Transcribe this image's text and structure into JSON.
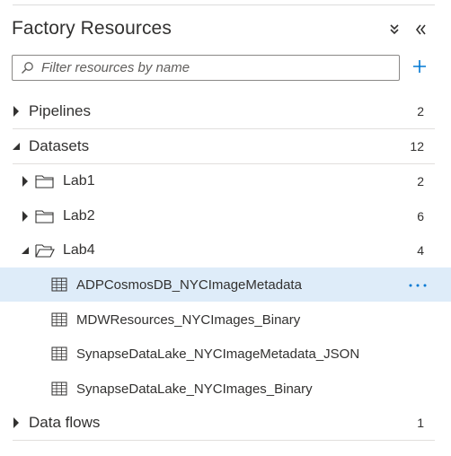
{
  "panel": {
    "title": "Factory Resources",
    "collapse_all_icon": "double-chevron-down-icon",
    "collapse_pane_icon": "double-chevron-left-icon"
  },
  "search": {
    "placeholder": "Filter resources by name",
    "value": "",
    "icon": "search-icon"
  },
  "add_button": {
    "icon": "plus-icon"
  },
  "categories": [
    {
      "label": "Pipelines",
      "count": "2",
      "expanded": false
    },
    {
      "label": "Datasets",
      "count": "12",
      "expanded": true
    },
    {
      "label": "Data flows",
      "count": "1",
      "expanded": false
    }
  ],
  "folders": [
    {
      "label": "Lab1",
      "count": "2",
      "expanded": false
    },
    {
      "label": "Lab2",
      "count": "6",
      "expanded": false
    },
    {
      "label": "Lab4",
      "count": "4",
      "expanded": true
    }
  ],
  "datasets": [
    {
      "label": "ADPCosmosDB_NYCImageMetadata",
      "selected": true
    },
    {
      "label": "MDWResources_NYCImages_Binary",
      "selected": false
    },
    {
      "label": "SynapseDataLake_NYCImageMetadata_JSON",
      "selected": false
    },
    {
      "label": "SynapseDataLake_NYCImages_Binary",
      "selected": false
    }
  ],
  "more_actions": {
    "label": "···"
  },
  "colors": {
    "accent": "#0078d4",
    "selected_row": "#deecf9",
    "text": "#323130",
    "divider": "#e1dfdd"
  }
}
